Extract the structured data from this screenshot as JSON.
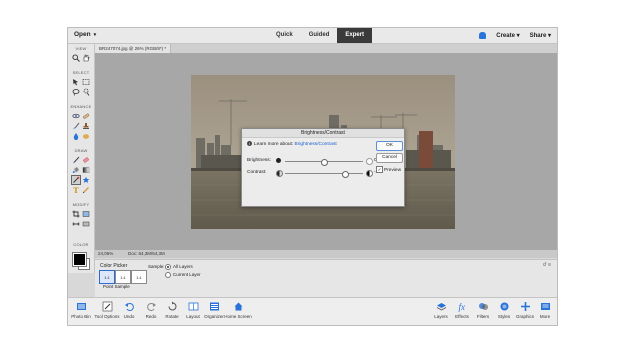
{
  "topbar": {
    "open_label": "Open",
    "modes": [
      "Quick",
      "Guided",
      "Expert"
    ],
    "active_mode": "Expert",
    "create_label": "Create",
    "share_label": "Share"
  },
  "document": {
    "tab_title": "BR247074.jpg @ 26% (RGB/8*) *",
    "zoom": "24,06%",
    "doc_info": "Doc: 64,3M/64,3M"
  },
  "toolbox": {
    "sections": [
      "VIEW",
      "SELECT",
      "ENHANCE",
      "DRAW",
      "MODIFY",
      "COLOR"
    ]
  },
  "dialog": {
    "title": "Brightness/Contrast",
    "learn_prefix": "Learn more about:",
    "learn_link": "Brightness/Contrast",
    "brightness_label": "Brightness:",
    "brightness_value": "0",
    "contrast_label": "Contrast:",
    "contrast_value": "-46",
    "ok_label": "OK",
    "cancel_label": "Cancel",
    "preview_label": "Preview",
    "brightness_level": 0.5,
    "contrast_level": 0.77
  },
  "options": {
    "title": "Color Picker",
    "point_sample": "Point Sample",
    "btn1": "1:1",
    "btn2": "1:1",
    "btn3": "1:1",
    "sample_label": "Sample:",
    "all_layers": "All Layers",
    "current_layer": "Current Layer"
  },
  "bottombar": {
    "left": [
      "Photo Bin",
      "Tool Options",
      "Undo",
      "Redo",
      "Rotate",
      "Layout",
      "Organizer",
      "Home Screen"
    ],
    "right": [
      "Layers",
      "Effects",
      "Filters",
      "Styles",
      "Graphics",
      "More"
    ]
  },
  "colors": {
    "accent": "#2a73d8",
    "active_mode_bg": "#3a3a3a"
  }
}
